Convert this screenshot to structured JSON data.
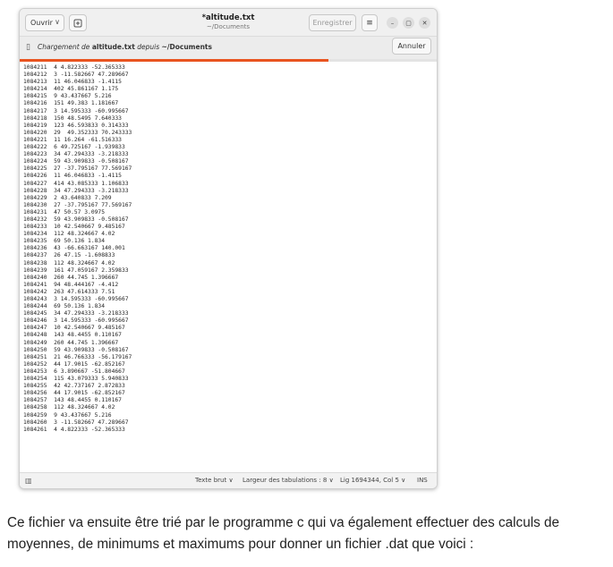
{
  "window": {
    "open_label": "Ouvrir",
    "new_tab_icon": "new-tab-icon",
    "title": "*altitude.txt",
    "path": "~/Documents",
    "save_label": "Enregistrer",
    "menu_icon": "≡",
    "minimize_icon": "–",
    "maximize_icon": "▢",
    "close_icon": "✕"
  },
  "infobar": {
    "prefix": "Chargement de ",
    "filename": "altitude.txt",
    "middle": " depuis ",
    "folder": "~/Documents",
    "cancel_label": "Annuler",
    "progress": 0.74,
    "accent": "#e95420"
  },
  "lines": [
    "1084211  4 4.822333 -52.365333",
    "1084212  3 -11.582667 47.289667",
    "1084213  11 46.046833 -1.4115",
    "1084214  402 45.861167 1.175",
    "1084215  9 43.437667 5.216",
    "1084216  151 49.383 1.181667",
    "1084217  3 14.595333 -60.995667",
    "1084218  150 48.5495 7.640333",
    "1084219  123 46.593833 0.314333",
    "1084220  29  49.352333 70.243333",
    "1084221  11 16.264 -61.516333",
    "1084222  6 49.725167 -1.939833",
    "1084223  34 47.294333 -3.218333",
    "1084224  59 43.909833 -0.508167",
    "1084225  27 -37.795167 77.569167",
    "1084226  11 46.046833 -1.4115",
    "1084227  414 43.085333 1.106833",
    "1084228  34 47.294333 -3.218333",
    "1084229  2 43.640833 7.209",
    "1084230  27 -37.795167 77.569167",
    "1084231  47 50.57 3.0975",
    "1084232  59 43.909833 -0.508167",
    "1084233  10 42.540667 9.485167",
    "1084234  112 48.324667 4.02",
    "1084235  69 50.136 1.834",
    "1084236  43 -66.663167 140.001",
    "1084237  26 47.15 -1.608833",
    "1084238  112 48.324667 4.02",
    "1084239  161 47.059167 2.359833",
    "1084240  260 44.745 1.396667",
    "1084241  94 48.444167 -4.412",
    "1084242  263 47.614333 7.51",
    "1084243  3 14.595333 -60.995667",
    "1084244  69 50.136 1.834",
    "1084245  34 47.294333 -3.218333",
    "1084246  3 14.595333 -60.995667",
    "1084247  10 42.540667 9.485167",
    "1084248  143 48.4455 0.110167",
    "1084249  260 44.745 1.396667",
    "1084250  59 43.909833 -0.508167",
    "1084251  21 46.766333 -56.179167",
    "1084252  44 17.9015 -62.852167",
    "1084253  6 3.890667 -51.804667",
    "1084254  115 43.079333 5.940833",
    "1084255  42 42.737167 2.872833",
    "1084256  44 17.9015 -62.852167",
    "1084257  143 48.4455 0.110167",
    "1084258  112 48.324667 4.02",
    "1084259  9 43.437667 5.216",
    "1084260  3 -11.582667 47.289667",
    "1084261  4 4.822333 -52.365333"
  ],
  "statusbar": {
    "format": "Texte brut",
    "tab_width": "Largeur des tabulations : 8",
    "position": "Lig 1694344, Col 5",
    "mode": "INS",
    "chevron": "∨"
  },
  "caption": "Ce fichier va ensuite être trié par le programme c qui va également effectuer des calculs de moyennes, de minimums et maximums pour donner un fichier .dat que voici :"
}
